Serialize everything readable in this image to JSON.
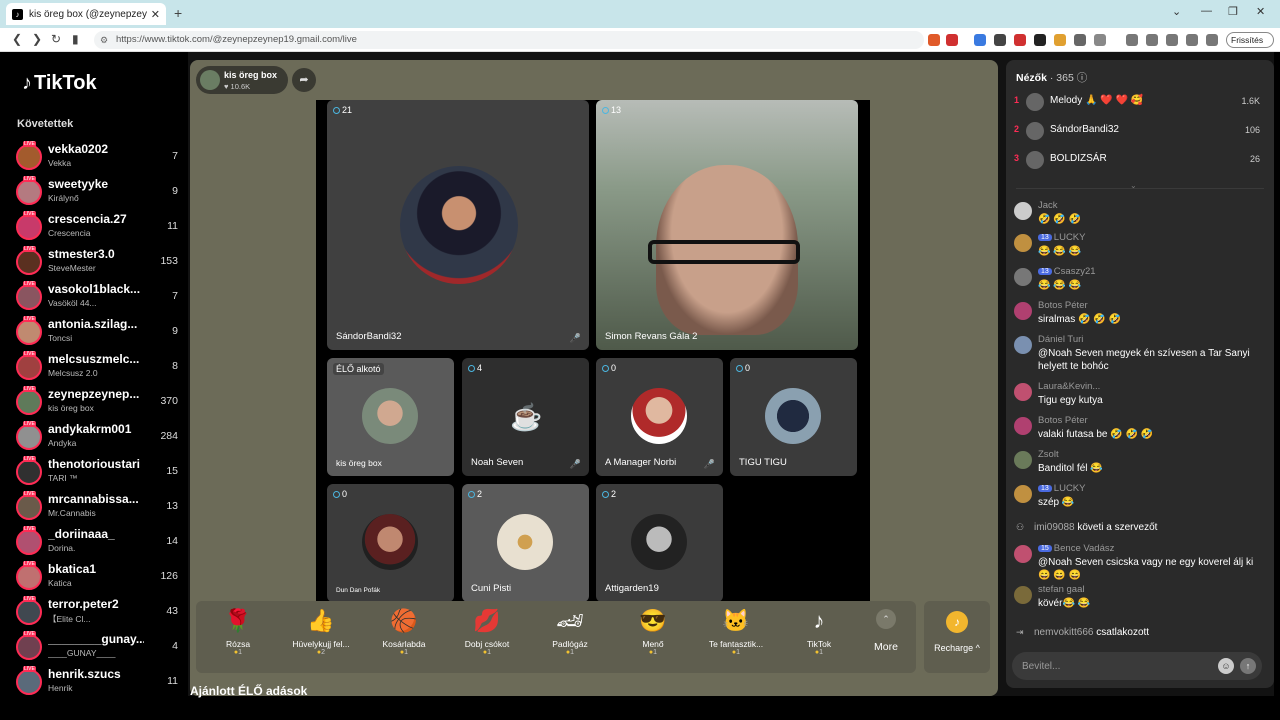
{
  "browser": {
    "tab_title": "kis öreg box (@zeynepzeyne",
    "url": "https://www.tiktok.com/@zeynepzeynep19.gmail.com/live",
    "refresh_label": "Frissítés"
  },
  "sidebar": {
    "logo": "TikTok",
    "following_title": "Követettek",
    "accounts": [
      {
        "name": "vekka0202",
        "sub": "Vekka",
        "count": "7",
        "color": "#a35b2d"
      },
      {
        "name": "sweetyyke",
        "sub": "Királynő",
        "count": "9",
        "color": "#b47a80"
      },
      {
        "name": "crescencia.27",
        "sub": "Crescencia",
        "count": "11",
        "color": "#c83a6a"
      },
      {
        "name": "stmester3.0",
        "sub": "SteveMester",
        "count": "153",
        "color": "#5a3020"
      },
      {
        "name": "vasokol1black...",
        "sub": "Vasököl 44...",
        "count": "7",
        "color": "#8a5560"
      },
      {
        "name": "antonia.szilag...",
        "sub": "Toncsi",
        "count": "9",
        "color": "#c08a70"
      },
      {
        "name": "melcsuszmelc...",
        "sub": "Melcsusz 2.0",
        "count": "8",
        "color": "#a04040"
      },
      {
        "name": "zeynepzeynep...",
        "sub": "kis öreg box",
        "count": "370",
        "color": "#5f7a5a"
      },
      {
        "name": "andykakrm001",
        "sub": "Andyka",
        "count": "284",
        "color": "#909090"
      },
      {
        "name": "thenotorioustari",
        "sub": "TARI ™",
        "count": "15",
        "color": "#303030"
      },
      {
        "name": "mrcannabissa...",
        "sub": "Mr.Cannabis",
        "count": "13",
        "color": "#6a5a4a"
      },
      {
        "name": "_doriinaaa_",
        "sub": "Dorina.",
        "count": "14",
        "color": "#b05070"
      },
      {
        "name": "bkatica1",
        "sub": "Katica",
        "count": "126",
        "color": "#c07070"
      },
      {
        "name": "terror.peter2",
        "sub": "【Elite Cl...",
        "count": "43",
        "color": "#404850"
      },
      {
        "name": "________gunay...",
        "sub": "____GUNAY____",
        "count": "4",
        "color": "#704050"
      },
      {
        "name": "henrik.szucs",
        "sub": "Henrik",
        "count": "11",
        "color": "#5a6a7a"
      }
    ]
  },
  "host": {
    "name": "kis öreg box",
    "likes": "10.6K"
  },
  "tiles": {
    "t1": {
      "count": "21",
      "label": "SándorBandi32"
    },
    "t2": {
      "count": "13",
      "label": "Simon Revans Gála 2"
    },
    "t3": {
      "count": "ÉLŐ alkotó",
      "label": "kis öreg box"
    },
    "t4": {
      "count": "4",
      "label": "Noah Seven"
    },
    "t5": {
      "count": "0",
      "label": "A Manager Norbi"
    },
    "t6": {
      "count": "0",
      "label": "TIGU TIGU"
    },
    "t7": {
      "count": "0",
      "label": "Dun Dan Pofák"
    },
    "t8": {
      "count": "2",
      "label": "Cuni Pisti"
    },
    "t9": {
      "count": "2",
      "label": "Attigarden19"
    }
  },
  "gifts": [
    {
      "name": "Rózsa",
      "price": "1",
      "icon": "🌹"
    },
    {
      "name": "Hüvelykujj fel...",
      "price": "2",
      "icon": "👍"
    },
    {
      "name": "Kosárlabda",
      "price": "1",
      "icon": "🏀"
    },
    {
      "name": "Dobj csókot",
      "price": "1",
      "icon": "💋"
    },
    {
      "name": "Padlógáz",
      "price": "1",
      "icon": "🏎"
    },
    {
      "name": "Menő",
      "price": "1",
      "icon": "😎"
    },
    {
      "name": "Te fantasztik...",
      "price": "1",
      "icon": "🐱"
    },
    {
      "name": "TikTok",
      "price": "1",
      "icon": "♪"
    }
  ],
  "more_label": "More",
  "recharge_label": "Recharge ^",
  "recommend_title": "Ajánlott ÉLŐ adások",
  "viewers": {
    "title": "Nézők",
    "count": "· 365"
  },
  "ranking": [
    {
      "rank": "1",
      "name": "Melody 🙏 ❤️ ❤️ 🥰",
      "score": "1.6K"
    },
    {
      "rank": "2",
      "name": "SándorBandi32",
      "score": "106"
    },
    {
      "rank": "3",
      "name": "BOLDIZSÁR",
      "score": "26"
    }
  ],
  "chat": [
    {
      "who": "Jack",
      "text": "🤣 🤣 🤣"
    },
    {
      "who": "LUCKY",
      "badge": "13",
      "text": "😂 😂 😂"
    },
    {
      "who": "Csaszy21",
      "badge": "13",
      "text": "😂 😂 😂"
    },
    {
      "who": "Botos Péter",
      "text": "siralmas 🤣 🤣 🤣"
    },
    {
      "who": "Dániel Turi",
      "text": "@Noah Seven megyek én szívesen a Tar Sanyi helyett te bohóc"
    },
    {
      "who": "Laura&Kevin...",
      "text": "Tigu egy kutya"
    },
    {
      "who": "Botos Péter",
      "text": "valaki futasa be 🤣 🤣 🤣"
    },
    {
      "who": "Zsolt",
      "text": "Banditol fél 😂"
    },
    {
      "who": "LUCKY",
      "badge": "13",
      "text": "szép 😂"
    },
    {
      "who": "Bence Vadász",
      "badge": "15",
      "text": "@Noah Seven csicska vagy ne egy koverel álj ki 😄 😄 😄"
    },
    {
      "who": "stefan gaal",
      "text": "kövér😂 😂"
    }
  ],
  "system": [
    {
      "user": "imi09088",
      "action": "követi a szervezőt"
    },
    {
      "user": "nemvokitt666",
      "action": "csatlakozott"
    }
  ],
  "chat_input": {
    "placeholder": "Bevitel..."
  }
}
